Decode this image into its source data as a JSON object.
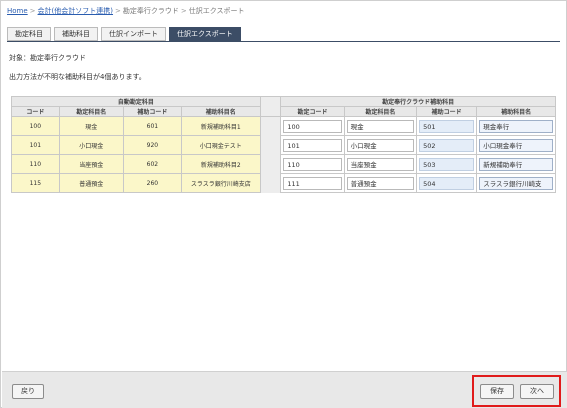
{
  "breadcrumb": {
    "home": "Home",
    "accounting": "会計(他会計ソフト連携)",
    "service": "勘定奉行クラウド",
    "current": "仕訳エクスポート",
    "separator": ">"
  },
  "tabs": [
    {
      "label": "勘定科目",
      "active": false
    },
    {
      "label": "補助科目",
      "active": false
    },
    {
      "label": "仕訳インポート",
      "active": false
    },
    {
      "label": "仕訳エクスポート",
      "active": true
    }
  ],
  "target_text": "対象：勘定奉行クラウド",
  "notice_text": "出力方法が不明な補助科目が4個あります。",
  "table": {
    "group_left": "自動勘定科目",
    "group_right": "勘定奉行クラウド補助科目",
    "headers_left": [
      "コード",
      "勘定科目名",
      "補助コード",
      "補助科目名"
    ],
    "headers_right": [
      "勘定コード",
      "勘定科目名",
      "補助コード",
      "補助科目名"
    ],
    "rows": [
      {
        "code": "100",
        "account": "現金",
        "sub_code": "601",
        "sub_name": "新規補助科目1",
        "map_code": "100",
        "map_account": "現金",
        "map_sub_code": "501",
        "map_sub_name": "現金奉行"
      },
      {
        "code": "101",
        "account": "小口現金",
        "sub_code": "920",
        "sub_name": "小口現金テスト",
        "map_code": "101",
        "map_account": "小口現金",
        "map_sub_code": "502",
        "map_sub_name": "小口現金奉行"
      },
      {
        "code": "110",
        "account": "当座預金",
        "sub_code": "602",
        "sub_name": "新規補助科目2",
        "map_code": "110",
        "map_account": "当座預金",
        "map_sub_code": "503",
        "map_sub_name": "新規補助奉行"
      },
      {
        "code": "115",
        "account": "普通預金",
        "sub_code": "260",
        "sub_name": "スラスラ銀行川崎支店",
        "map_code": "111",
        "map_account": "普通預金",
        "map_sub_code": "504",
        "map_sub_name": "スラスラ銀行川崎支"
      }
    ]
  },
  "buttons": {
    "back": "戻り",
    "save": "保存",
    "next": "次へ"
  },
  "colors": {
    "accent": "#3c4d66",
    "highlight": "#e01b1b",
    "left_cell": "#fbf7c9"
  }
}
